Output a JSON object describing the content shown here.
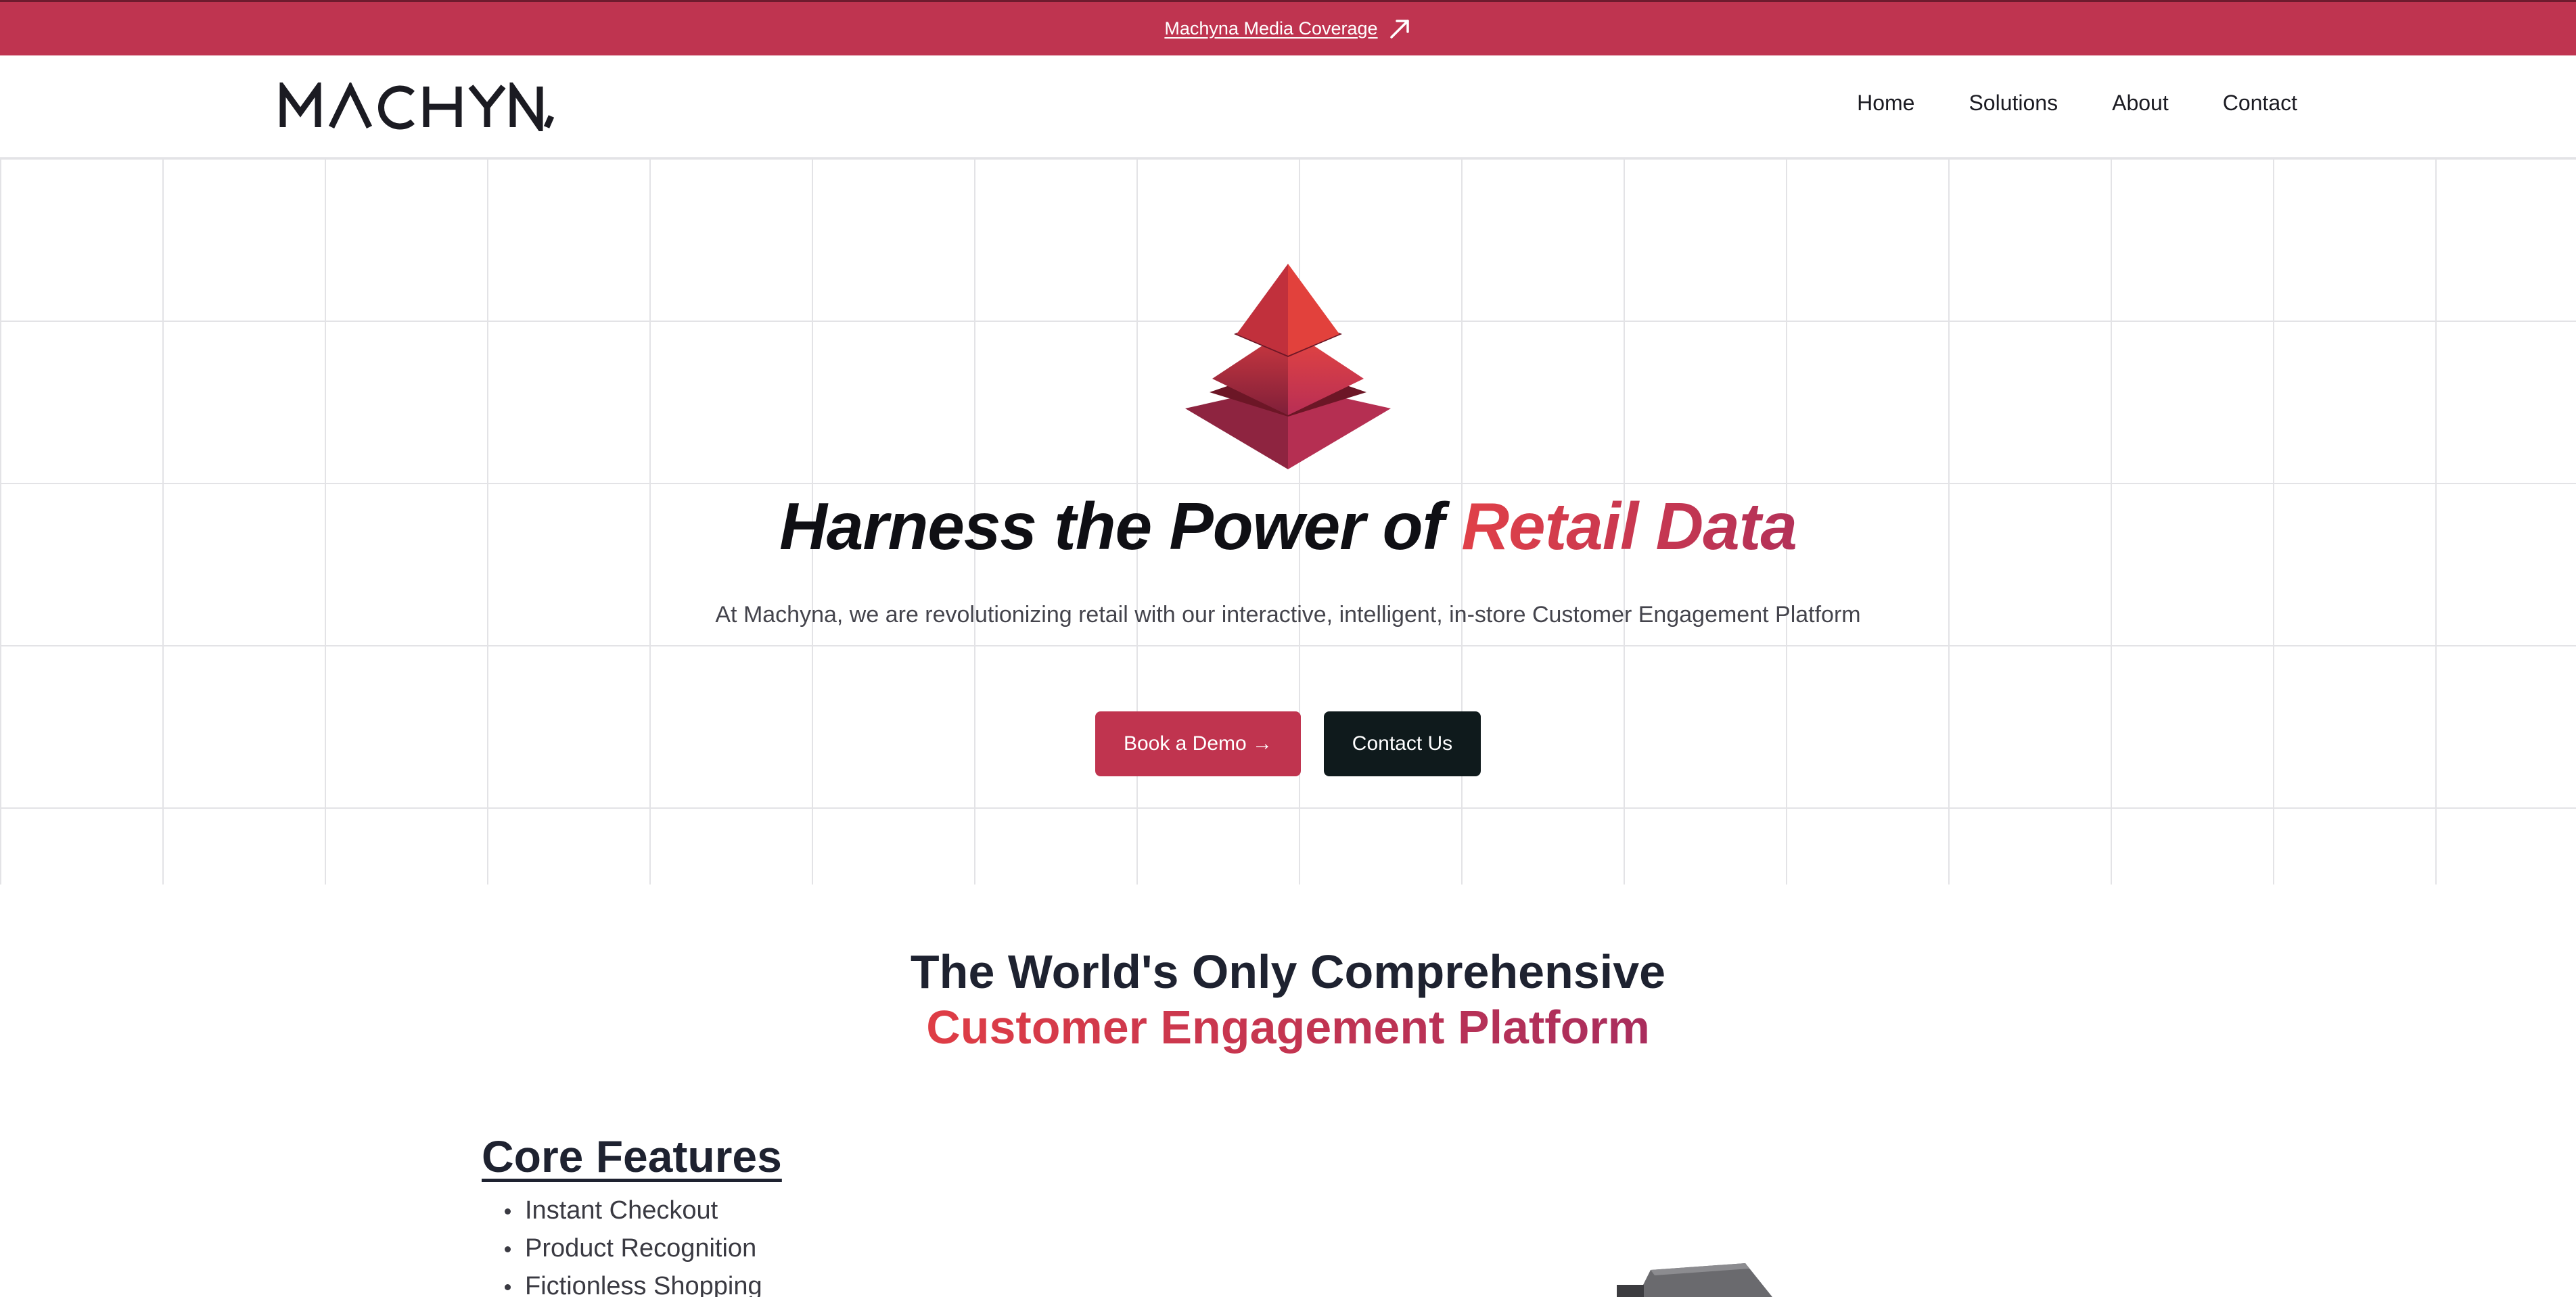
{
  "announcement": {
    "link_text": "Machyna Media Coverage",
    "icon": "arrow-up-right-icon",
    "background": "#bf3450"
  },
  "header": {
    "logo_text": "MACHYNA",
    "nav": [
      {
        "label": "Home"
      },
      {
        "label": "Solutions"
      },
      {
        "label": "About"
      },
      {
        "label": "Contact"
      }
    ]
  },
  "hero": {
    "title_prefix": "Harness the Power of ",
    "title_accent": "Retail Data",
    "subtitle": "At Machyna, we are revolutionizing retail with our interactive, intelligent, in-store Customer Engagement Platform",
    "primary_button": "Book a Demo →",
    "secondary_button": "Contact Us",
    "accent_color": "#c0344f",
    "dark_button_color": "#0f1a1c"
  },
  "platform": {
    "title_line1": "The World's Only Comprehensive",
    "title_line2": "Customer Engagement Platform"
  },
  "features": {
    "heading": "Core Features",
    "items": [
      "Instant Checkout",
      "Product Recognition",
      "Fictionless Shopping"
    ]
  }
}
